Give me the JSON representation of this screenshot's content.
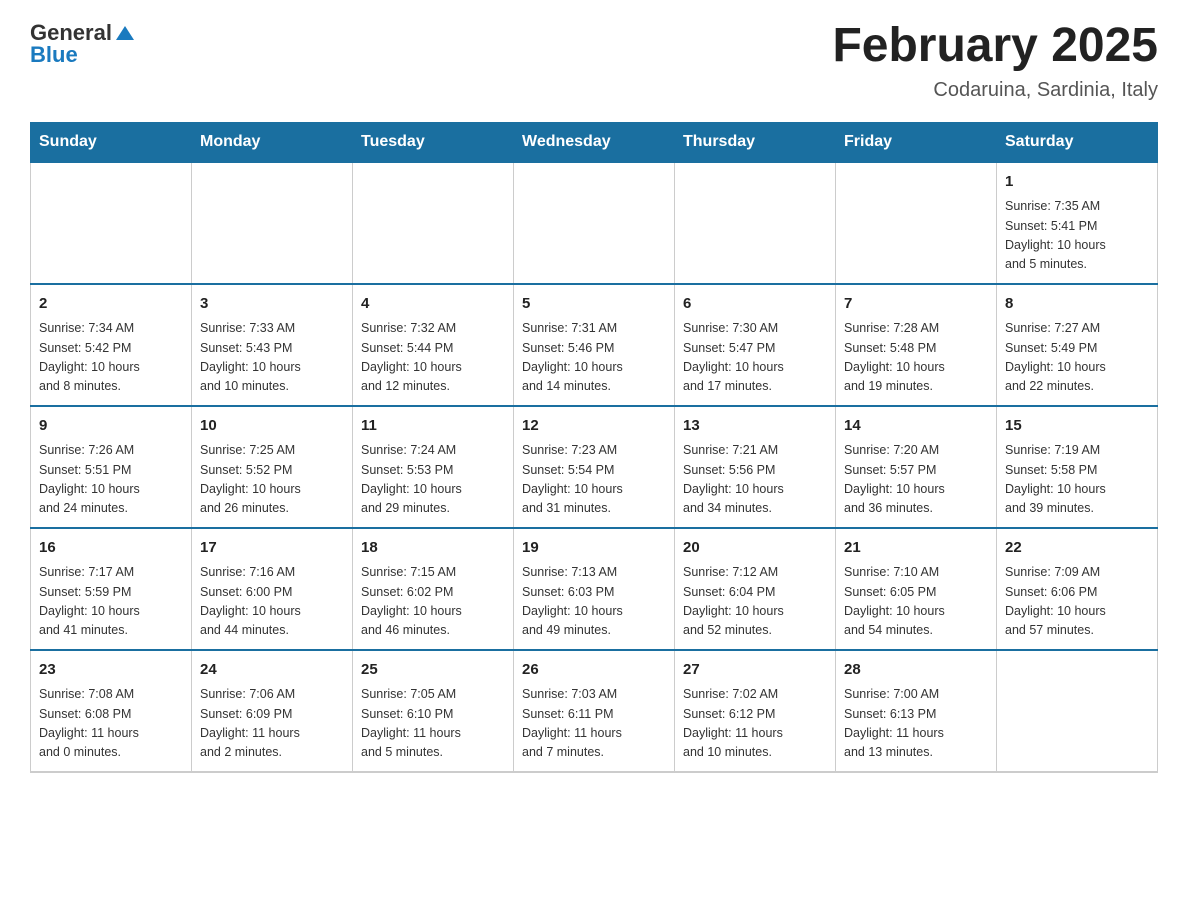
{
  "header": {
    "title": "February 2025",
    "subtitle": "Codaruina, Sardinia, Italy",
    "logo": {
      "general": "General",
      "blue": "Blue"
    }
  },
  "weekdays": [
    "Sunday",
    "Monday",
    "Tuesday",
    "Wednesday",
    "Thursday",
    "Friday",
    "Saturday"
  ],
  "weeks": [
    [
      {
        "day": "",
        "info": ""
      },
      {
        "day": "",
        "info": ""
      },
      {
        "day": "",
        "info": ""
      },
      {
        "day": "",
        "info": ""
      },
      {
        "day": "",
        "info": ""
      },
      {
        "day": "",
        "info": ""
      },
      {
        "day": "1",
        "info": "Sunrise: 7:35 AM\nSunset: 5:41 PM\nDaylight: 10 hours\nand 5 minutes."
      }
    ],
    [
      {
        "day": "2",
        "info": "Sunrise: 7:34 AM\nSunset: 5:42 PM\nDaylight: 10 hours\nand 8 minutes."
      },
      {
        "day": "3",
        "info": "Sunrise: 7:33 AM\nSunset: 5:43 PM\nDaylight: 10 hours\nand 10 minutes."
      },
      {
        "day": "4",
        "info": "Sunrise: 7:32 AM\nSunset: 5:44 PM\nDaylight: 10 hours\nand 12 minutes."
      },
      {
        "day": "5",
        "info": "Sunrise: 7:31 AM\nSunset: 5:46 PM\nDaylight: 10 hours\nand 14 minutes."
      },
      {
        "day": "6",
        "info": "Sunrise: 7:30 AM\nSunset: 5:47 PM\nDaylight: 10 hours\nand 17 minutes."
      },
      {
        "day": "7",
        "info": "Sunrise: 7:28 AM\nSunset: 5:48 PM\nDaylight: 10 hours\nand 19 minutes."
      },
      {
        "day": "8",
        "info": "Sunrise: 7:27 AM\nSunset: 5:49 PM\nDaylight: 10 hours\nand 22 minutes."
      }
    ],
    [
      {
        "day": "9",
        "info": "Sunrise: 7:26 AM\nSunset: 5:51 PM\nDaylight: 10 hours\nand 24 minutes."
      },
      {
        "day": "10",
        "info": "Sunrise: 7:25 AM\nSunset: 5:52 PM\nDaylight: 10 hours\nand 26 minutes."
      },
      {
        "day": "11",
        "info": "Sunrise: 7:24 AM\nSunset: 5:53 PM\nDaylight: 10 hours\nand 29 minutes."
      },
      {
        "day": "12",
        "info": "Sunrise: 7:23 AM\nSunset: 5:54 PM\nDaylight: 10 hours\nand 31 minutes."
      },
      {
        "day": "13",
        "info": "Sunrise: 7:21 AM\nSunset: 5:56 PM\nDaylight: 10 hours\nand 34 minutes."
      },
      {
        "day": "14",
        "info": "Sunrise: 7:20 AM\nSunset: 5:57 PM\nDaylight: 10 hours\nand 36 minutes."
      },
      {
        "day": "15",
        "info": "Sunrise: 7:19 AM\nSunset: 5:58 PM\nDaylight: 10 hours\nand 39 minutes."
      }
    ],
    [
      {
        "day": "16",
        "info": "Sunrise: 7:17 AM\nSunset: 5:59 PM\nDaylight: 10 hours\nand 41 minutes."
      },
      {
        "day": "17",
        "info": "Sunrise: 7:16 AM\nSunset: 6:00 PM\nDaylight: 10 hours\nand 44 minutes."
      },
      {
        "day": "18",
        "info": "Sunrise: 7:15 AM\nSunset: 6:02 PM\nDaylight: 10 hours\nand 46 minutes."
      },
      {
        "day": "19",
        "info": "Sunrise: 7:13 AM\nSunset: 6:03 PM\nDaylight: 10 hours\nand 49 minutes."
      },
      {
        "day": "20",
        "info": "Sunrise: 7:12 AM\nSunset: 6:04 PM\nDaylight: 10 hours\nand 52 minutes."
      },
      {
        "day": "21",
        "info": "Sunrise: 7:10 AM\nSunset: 6:05 PM\nDaylight: 10 hours\nand 54 minutes."
      },
      {
        "day": "22",
        "info": "Sunrise: 7:09 AM\nSunset: 6:06 PM\nDaylight: 10 hours\nand 57 minutes."
      }
    ],
    [
      {
        "day": "23",
        "info": "Sunrise: 7:08 AM\nSunset: 6:08 PM\nDaylight: 11 hours\nand 0 minutes."
      },
      {
        "day": "24",
        "info": "Sunrise: 7:06 AM\nSunset: 6:09 PM\nDaylight: 11 hours\nand 2 minutes."
      },
      {
        "day": "25",
        "info": "Sunrise: 7:05 AM\nSunset: 6:10 PM\nDaylight: 11 hours\nand 5 minutes."
      },
      {
        "day": "26",
        "info": "Sunrise: 7:03 AM\nSunset: 6:11 PM\nDaylight: 11 hours\nand 7 minutes."
      },
      {
        "day": "27",
        "info": "Sunrise: 7:02 AM\nSunset: 6:12 PM\nDaylight: 11 hours\nand 10 minutes."
      },
      {
        "day": "28",
        "info": "Sunrise: 7:00 AM\nSunset: 6:13 PM\nDaylight: 11 hours\nand 13 minutes."
      },
      {
        "day": "",
        "info": ""
      }
    ]
  ]
}
